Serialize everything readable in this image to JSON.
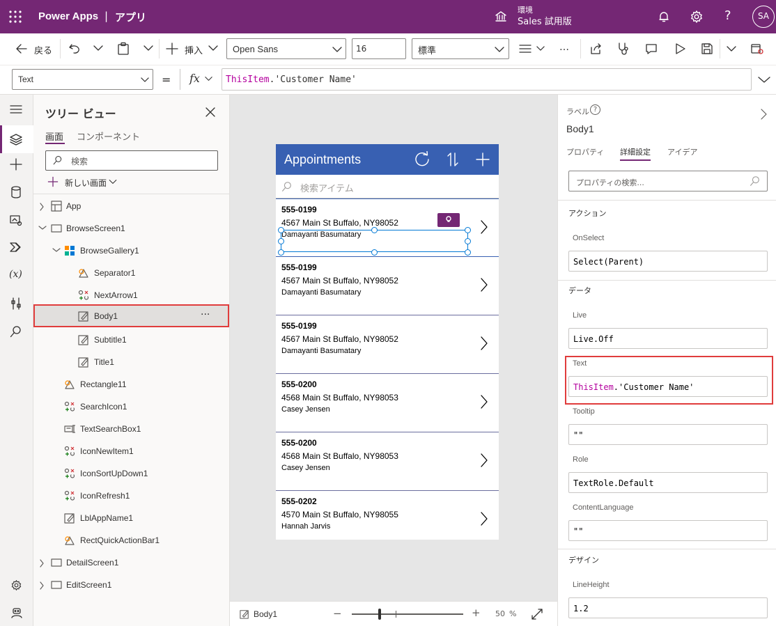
{
  "top": {
    "app_name": "Power Apps",
    "separator": "|",
    "page": "アプリ",
    "env_label": "環境",
    "env_name": "Sales 試用版",
    "avatar": "SA"
  },
  "cmd": {
    "back": "戻る",
    "insert": "挿入",
    "font": "Open Sans",
    "size": "16",
    "weight": "標準",
    "more": "…"
  },
  "formula": {
    "property": "Text",
    "equals": "=",
    "fx": "fx",
    "keyword": "ThisItem",
    "rest": ".'Customer Name'"
  },
  "tree": {
    "title": "ツリー ビュー",
    "tab_screens": "画面",
    "tab_components": "コンポーネント",
    "search_placeholder": "検索",
    "new_screen": "新しい画面",
    "nodes": [
      {
        "label": "App",
        "icon": "app-icon"
      },
      {
        "label": "BrowseScreen1",
        "icon": "screen-icon"
      },
      {
        "label": "BrowseGallery1",
        "icon": "gallery-icon"
      },
      {
        "label": "Separator1",
        "icon": "shape-icon"
      },
      {
        "label": "NextArrow1",
        "icon": "icon-control-icon"
      },
      {
        "label": "Body1",
        "icon": "label-icon"
      },
      {
        "label": "Subtitle1",
        "icon": "label-icon"
      },
      {
        "label": "Title1",
        "icon": "label-icon"
      },
      {
        "label": "Rectangle11",
        "icon": "shape-icon"
      },
      {
        "label": "SearchIcon1",
        "icon": "icon-control-icon"
      },
      {
        "label": "TextSearchBox1",
        "icon": "textbox-icon"
      },
      {
        "label": "IconNewItem1",
        "icon": "icon-control-icon"
      },
      {
        "label": "IconSortUpDown1",
        "icon": "icon-control-icon"
      },
      {
        "label": "IconRefresh1",
        "icon": "icon-control-icon"
      },
      {
        "label": "LblAppName1",
        "icon": "label-icon"
      },
      {
        "label": "RectQuickActionBar1",
        "icon": "shape-icon"
      },
      {
        "label": "DetailScreen1",
        "icon": "screen-icon"
      },
      {
        "label": "EditScreen1",
        "icon": "screen-icon"
      }
    ],
    "more": "···"
  },
  "app": {
    "header_title": "Appointments",
    "search_placeholder": "検索アイテム",
    "items": [
      {
        "title": "555-0199",
        "subtitle": "4567 Main St Buffalo, NY98052",
        "body": "Damayanti Basumatary"
      },
      {
        "title": "555-0199",
        "subtitle": "4567 Main St Buffalo, NY98052",
        "body": "Damayanti Basumatary"
      },
      {
        "title": "555-0199",
        "subtitle": "4567 Main St Buffalo, NY98052",
        "body": "Damayanti Basumatary"
      },
      {
        "title": "555-0200",
        "subtitle": "4568 Main St Buffalo, NY98053",
        "body": "Casey Jensen"
      },
      {
        "title": "555-0200",
        "subtitle": "4568 Main St Buffalo, NY98053",
        "body": "Casey Jensen"
      },
      {
        "title": "555-0202",
        "subtitle": "4570 Main St Buffalo, NY98055",
        "body": "Hannah Jarvis"
      }
    ]
  },
  "status": {
    "selected": "Body1",
    "zoom_minus": "−",
    "zoom_plus": "+",
    "zoom_value": "50",
    "zoom_unit": "%",
    "zoom_level": 0.5
  },
  "props": {
    "type": "ラベル",
    "name": "Body1",
    "tabs": [
      "プロパティ",
      "詳細設定",
      "アイデア"
    ],
    "active_tab": 1,
    "search_placeholder": "プロパティの検索...",
    "sec_action": "アクション",
    "onselect_label": "OnSelect",
    "onselect_value": "Select(Parent)",
    "sec_data": "データ",
    "live_label": "Live",
    "live_value": "Live.Off",
    "text_label": "Text",
    "text_keyword": "ThisItem",
    "text_rest": ".'Customer Name'",
    "tooltip_label": "Tooltip",
    "tooltip_value": "\"\"",
    "role_label": "Role",
    "role_value": "TextRole.Default",
    "contentlang_label": "ContentLanguage",
    "contentlang_value": "\"\"",
    "sec_design": "デザイン",
    "lineheight_label": "LineHeight",
    "lineheight_value": "1.2"
  },
  "colors": {
    "brand": "#742774",
    "app_header": "#3860b2",
    "highlight": "#d13438",
    "keyword": "#b4009e"
  }
}
